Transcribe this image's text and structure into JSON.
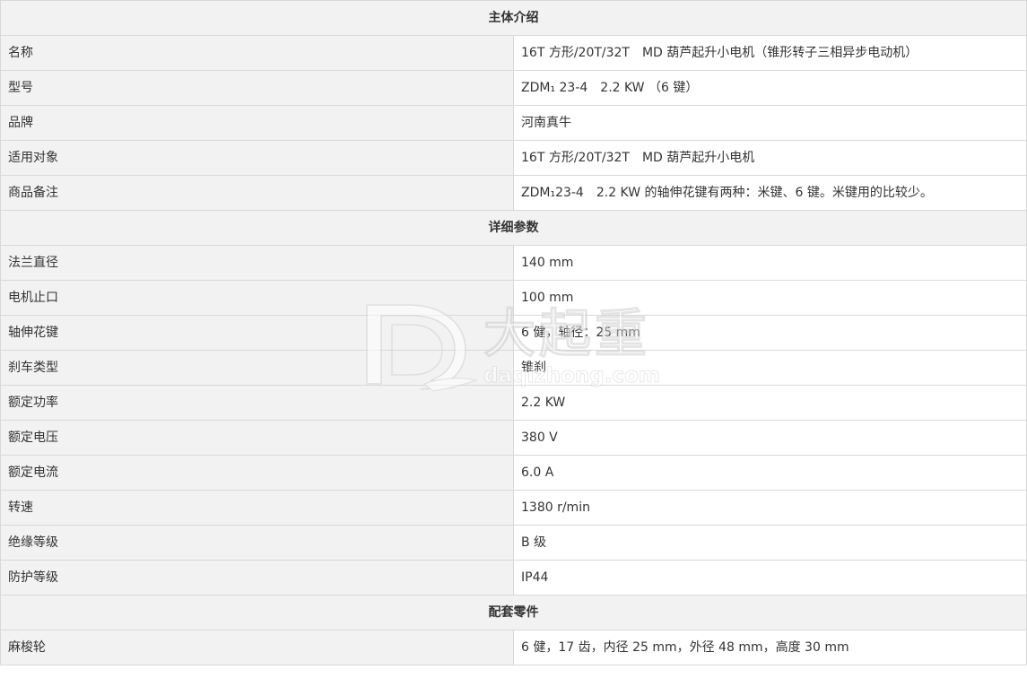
{
  "sections": {
    "intro": {
      "title": "主体介绍",
      "rows": [
        {
          "label": "名称",
          "value": "16T 方形/20T/32T　MD 葫芦起升小电机（锥形转子三相异步电动机）"
        },
        {
          "label": "型号",
          "value": "ZDM₁ 23-4　2.2 KW （6 键）"
        },
        {
          "label": "品牌",
          "value": "河南真牛"
        },
        {
          "label": "适用对象",
          "value": "16T 方形/20T/32T　MD 葫芦起升小电机"
        },
        {
          "label": "商品备注",
          "value": "ZDM₁23-4　2.2 KW 的轴伸花键有两种：米键、6 键。米键用的比较少。"
        }
      ]
    },
    "params": {
      "title": "详细参数",
      "rows": [
        {
          "label": "法兰直径",
          "value": "140 mm"
        },
        {
          "label": "电机止口",
          "value": "100 mm"
        },
        {
          "label": "轴伸花键",
          "value": "6 健，轴径：25 mm"
        },
        {
          "label": "刹车类型",
          "value": "锥刹"
        },
        {
          "label": "额定功率",
          "value": "2.2 KW"
        },
        {
          "label": "额定电压",
          "value": "380 V"
        },
        {
          "label": "额定电流",
          "value": "6.0 A"
        },
        {
          "label": "转速",
          "value": "1380 r/min"
        },
        {
          "label": "绝缘等级",
          "value": "B 级"
        },
        {
          "label": "防护等级",
          "value": "IP44"
        }
      ]
    },
    "parts": {
      "title": "配套零件",
      "rows": [
        {
          "label": "麻梭轮",
          "value": "6 健，17 齿，内径 25 mm，外径 48 mm，高度 30 mm"
        }
      ]
    }
  },
  "watermark": {
    "brand_cn": "大起重",
    "domain": "daqizhong.com",
    "logo_icon": "dq-logo-icon"
  },
  "colors": {
    "header_bg": "#f2f2f2",
    "label_bg": "#f2f2f2",
    "border": "#d9d9d9",
    "text": "#333333"
  }
}
